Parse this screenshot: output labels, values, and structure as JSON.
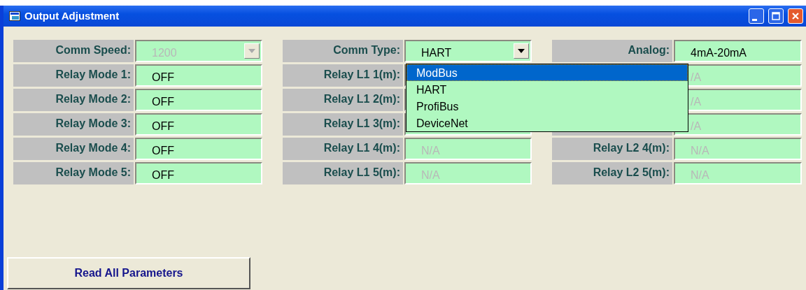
{
  "window": {
    "title": "Output Adjustment"
  },
  "columns": [
    {
      "rows": [
        {
          "label": "Comm Speed:",
          "kind": "combo",
          "value": "1200",
          "disabled": true
        },
        {
          "label": "Relay Mode 1:",
          "kind": "text",
          "value": "OFF",
          "disabled": false
        },
        {
          "label": "Relay Mode 2:",
          "kind": "text",
          "value": "OFF",
          "disabled": false
        },
        {
          "label": "Relay Mode 3:",
          "kind": "text",
          "value": "OFF",
          "disabled": false
        },
        {
          "label": "Relay Mode 4:",
          "kind": "text",
          "value": "OFF",
          "disabled": false
        },
        {
          "label": "Relay Mode 5:",
          "kind": "text",
          "value": "OFF",
          "disabled": false
        }
      ]
    },
    {
      "rows": [
        {
          "label": "Comm Type:",
          "kind": "combo",
          "value": "HART",
          "disabled": false,
          "expanded": true,
          "options": [
            {
              "label": "ModBus",
              "highlighted": true
            },
            {
              "label": "HART",
              "highlighted": false
            },
            {
              "label": "ProfiBus",
              "highlighted": false
            },
            {
              "label": "DeviceNet",
              "highlighted": false
            }
          ]
        },
        {
          "label": "Relay L1 1(m):",
          "kind": "text"
        },
        {
          "label": "Relay L1 2(m):",
          "kind": "text"
        },
        {
          "label": "Relay L1 3(m):",
          "kind": "text"
        },
        {
          "label": "Relay L1 4(m):",
          "kind": "text",
          "value": "N/A",
          "disabled": true
        },
        {
          "label": "Relay L1 5(m):",
          "kind": "text",
          "value": "N/A",
          "disabled": true
        }
      ]
    },
    {
      "rows": [
        {
          "label": "Analog:",
          "kind": "text",
          "value": "4mA-20mA",
          "disabled": false
        },
        {
          "kind": "text",
          "value": "/A",
          "disabled": true
        },
        {
          "kind": "text",
          "value": "/A",
          "disabled": true
        },
        {
          "kind": "text",
          "value": "/A",
          "disabled": true
        },
        {
          "label": "Relay L2 4(m):",
          "kind": "text",
          "value": "N/A",
          "disabled": true
        },
        {
          "label": "Relay L2 5(m):",
          "kind": "text",
          "value": "N/A",
          "disabled": true
        }
      ]
    }
  ],
  "button": {
    "label": "Read All Parameters"
  }
}
